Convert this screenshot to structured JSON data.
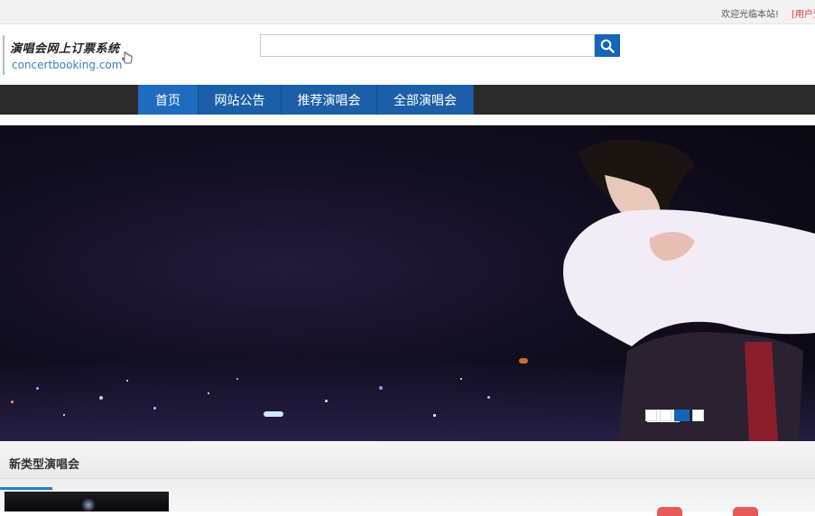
{
  "topbar": {
    "welcome": "欢迎光临本站!",
    "user_link": "[用户登"
  },
  "header": {
    "logo_title": "演唱会网上订票系统",
    "logo_domain": "concertbooking.com",
    "search": {
      "value": "",
      "placeholder": ""
    }
  },
  "nav": {
    "items": [
      {
        "label": "首页"
      },
      {
        "label": "网站公告"
      },
      {
        "label": "推荐演唱会"
      },
      {
        "label": "全部演唱会"
      }
    ]
  },
  "banner": {
    "slide_count": 4,
    "active_slide": 3
  },
  "section": {
    "title": "新类型演唱会"
  },
  "colors": {
    "primary": "#1565b8",
    "nav_bg": "#2b2b2b",
    "accent_red": "#e23a3a"
  },
  "icons": [
    "search-icon",
    "cursor-icon"
  ]
}
